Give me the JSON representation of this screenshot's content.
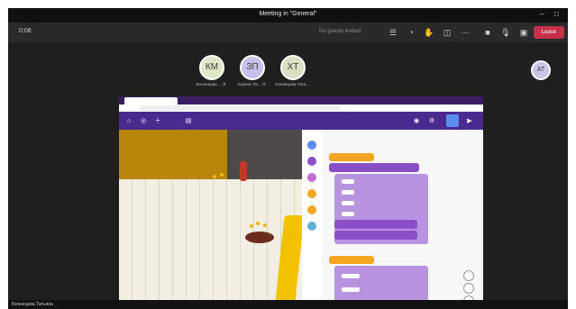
{
  "window": {
    "title": "Meeting in \"General\"",
    "minimize": "–",
    "restore": "□"
  },
  "toolbar": {
    "elapsed": "0:08",
    "hint": "No guests invited",
    "leave_label": "Leave",
    "icons": [
      "people-icon",
      "chat-icon",
      "hand-icon",
      "breakout-icon",
      "more-icon",
      "camera-icon",
      "mic-icon",
      "share-icon"
    ]
  },
  "participants": [
    {
      "initials": "КМ",
      "name": "Ксюнецова ... ℝ"
    },
    {
      "initials": "ЗП",
      "name": "Зорина Тат... ℝ"
    },
    {
      "initials": "ХТ",
      "name": "Ксюнецова Тата..."
    }
  ],
  "right_participant": {
    "initials": "AT"
  },
  "presenter_label": "Ксюнецова Татьяна",
  "colors": {
    "leave": "#c4314b",
    "app_bar": "#4a2a8f",
    "block_purple": "#8a4fc7",
    "block_orange": "#f5a623"
  }
}
